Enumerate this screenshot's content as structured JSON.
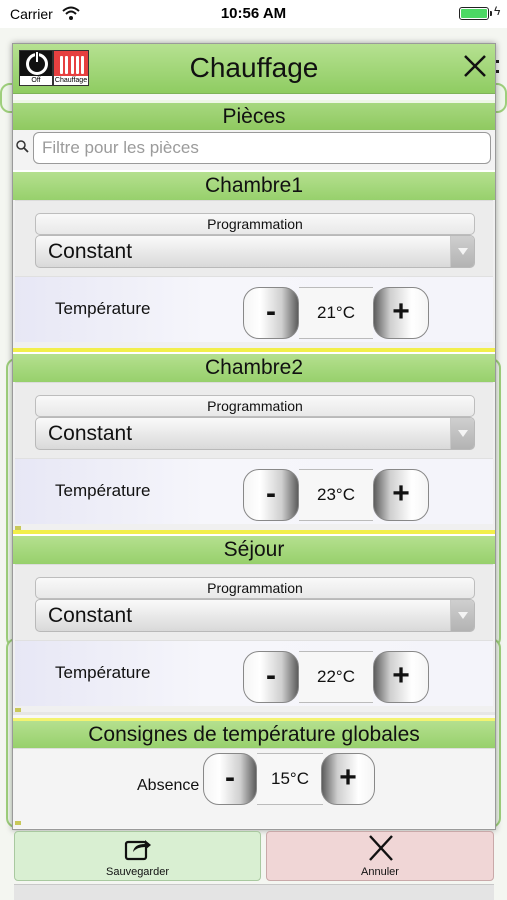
{
  "status_bar": {
    "carrier": "Carrier",
    "time": "10:56 AM"
  },
  "header": {
    "off_label": "Off",
    "heating_label": "Chauffage",
    "title": "Chauffage",
    "close_icon": "close-icon"
  },
  "pieces": {
    "title": "Pièces",
    "filter_placeholder": "Filtre pour les pièces"
  },
  "rooms": [
    {
      "name": "Chambre1",
      "programmation_label": "Programmation",
      "programmation_value": "Constant",
      "temperature_label": "Température",
      "temperature_value": "21°C",
      "minus": "-",
      "plus": "+"
    },
    {
      "name": "Chambre2",
      "programmation_label": "Programmation",
      "programmation_value": "Constant",
      "temperature_label": "Température",
      "temperature_value": "23°C",
      "minus": "-",
      "plus": "+"
    },
    {
      "name": "Séjour",
      "programmation_label": "Programmation",
      "programmation_value": "Constant",
      "temperature_label": "Température",
      "temperature_value": "22°C",
      "minus": "-",
      "plus": "+"
    }
  ],
  "global": {
    "title": "Consignes de température globales",
    "absence_label": "Absence",
    "absence_value": "15°C",
    "minus": "-",
    "plus": "+"
  },
  "footer": {
    "save_label": "Sauvegarder",
    "cancel_label": "Annuler"
  },
  "colors": {
    "header_green": "#8fcc62",
    "section_green": "#97d06c",
    "heating_red": "#e64040",
    "save_bg": "#d9efd2",
    "cancel_bg": "#f0d6d6"
  }
}
